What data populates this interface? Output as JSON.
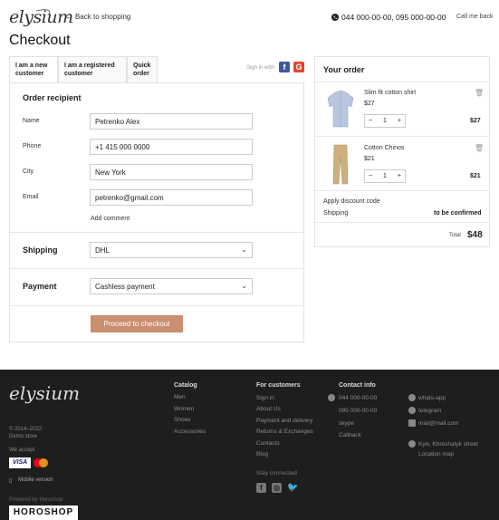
{
  "header": {
    "logo": "elysium",
    "back_link": "Back to shopping",
    "phones": "044 000-00-00,  095 000-00-00",
    "call_me": "Call me back"
  },
  "page_title": "Checkout",
  "tabs": [
    {
      "label": "I am a new customer",
      "active": true
    },
    {
      "label": "I am a registered customer",
      "active": false
    },
    {
      "label": "Quick order",
      "active": false
    }
  ],
  "signin_with": "Sign in with",
  "form": {
    "recipient_title": "Order recipient",
    "fields": [
      {
        "label": "Name",
        "value": "Petrenko Alex"
      },
      {
        "label": "Phone",
        "value": "+1 415 000 0000"
      },
      {
        "label": "City",
        "value": "New York"
      },
      {
        "label": "Email",
        "value": "petrenko@gmail.com"
      }
    ],
    "add_comment": "Add comment",
    "shipping_label": "Shipping",
    "shipping_value": "DHL",
    "payment_label": "Payment",
    "payment_value": "Cashless payment",
    "submit": "Proceed to checkout"
  },
  "order": {
    "title": "Your order",
    "items": [
      {
        "name": "Slim fit cotton shirt",
        "price": "$27",
        "qty": "1",
        "total": "$27"
      },
      {
        "name": "Cotton Chinos",
        "price": "$21",
        "qty": "1",
        "total": "$21"
      }
    ],
    "discount": "Apply discount code",
    "shipping_label": "Shipping",
    "shipping_value": "to be confirmed",
    "total_label": "Total",
    "total_value": "$48"
  },
  "footer": {
    "logo": "elysium",
    "copyright": "© 2014–2022",
    "demo": "Demo store",
    "we_accept": "We accept",
    "visa": "VISA",
    "mobile": "Mobile version",
    "powered": "Powered by Horoshop",
    "horoshop": "HOROSHOP",
    "catalog_title": "Catalog",
    "catalog": [
      "Men",
      "Women",
      "Shoes",
      "Accessories"
    ],
    "customers_title": "For customers",
    "customers": [
      "Sign in",
      "About Us",
      "Payment and delivery",
      "Returns & Exchanges",
      "Contacts",
      "Blog"
    ],
    "stay_connected": "Stay connected",
    "contact_title": "Contact info",
    "contacts": [
      "044 000-00-00",
      "095 000-00-00",
      "skype",
      "Callback"
    ],
    "contacts2": [
      "whats-app",
      "telegram",
      "mail@mail.com"
    ],
    "address": [
      "Kyiv, Khreshatyk street",
      "Location map"
    ]
  },
  "colors": {
    "accent": "#c98f6f",
    "footer_bg": "#1e1e1e"
  }
}
